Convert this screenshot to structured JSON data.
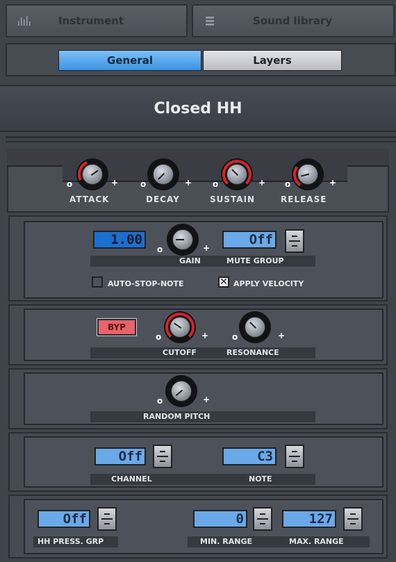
{
  "tabs": {
    "instrument": "Instrument",
    "sound_library": "Sound library"
  },
  "subtabs": {
    "general": "General",
    "layers": "Layers"
  },
  "instrument_name": "Closed HH",
  "envelope": {
    "attack": "ATTACK",
    "decay": "DECAY",
    "sustain": "SUSTAIN",
    "release": "RELEASE"
  },
  "gain_panel": {
    "gain_value": "1.00",
    "gain_label": "GAIN",
    "mute_value": "Off",
    "mute_label": "MUTE GROUP",
    "auto_stop": "AUTO-STOP-NOTE",
    "apply_velocity": "APPLY VELOCITY"
  },
  "filter_panel": {
    "bypass": "BYP",
    "cutoff": "CUTOFF",
    "resonance": "RESONANCE"
  },
  "pitch_panel": {
    "random_pitch": "RANDOM PITCH"
  },
  "midi_panel": {
    "channel_value": "Off",
    "channel_label": "CHANNEL",
    "note_value": "C3",
    "note_label": "NOTE"
  },
  "hh_panel": {
    "press_value": "Off",
    "press_label": "HH PRESS. GRP",
    "min_value": "0",
    "min_label": "MIN. RANGE",
    "max_value": "127",
    "max_label": "MAX. RANGE"
  },
  "colors": {
    "lcd_blue": "#1b6fd0",
    "active_tab": "#56a8ee",
    "knob_red": "#d8232a",
    "bypass": "#e8636b"
  }
}
